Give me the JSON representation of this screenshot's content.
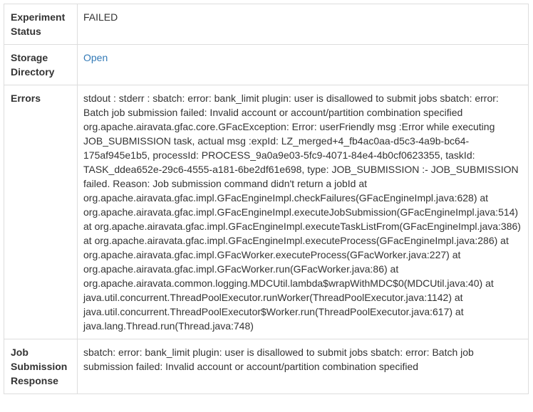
{
  "rows": [
    {
      "label": "Experiment Status",
      "value": "FAILED"
    },
    {
      "label": "Storage Directory",
      "link_text": "Open"
    },
    {
      "label": "Errors",
      "value": "stdout : stderr : sbatch: error: bank_limit plugin: user is disallowed to submit jobs sbatch: error: Batch job submission failed: Invalid account or account/partition combination specified org.apache.airavata.gfac.core.GFacException: Error: userFriendly msg :Error while executing JOB_SUBMISSION task, actual msg :expId: LZ_merged+4_fb4ac0aa-d5c3-4a9b-bc64-175af945e1b5, processId: PROCESS_9a0a9e03-5fc9-4071-84e4-4b0cf0623355, taskId: TASK_ddea652e-29c6-4555-a181-6be2df61e698, type: JOB_SUBMISSION :- JOB_SUBMISSION failed. Reason: Job submission command didn't return a jobId at org.apache.airavata.gfac.impl.GFacEngineImpl.checkFailures(GFacEngineImpl.java:628) at org.apache.airavata.gfac.impl.GFacEngineImpl.executeJobSubmission(GFacEngineImpl.java:514) at org.apache.airavata.gfac.impl.GFacEngineImpl.executeTaskListFrom(GFacEngineImpl.java:386) at org.apache.airavata.gfac.impl.GFacEngineImpl.executeProcess(GFacEngineImpl.java:286) at org.apache.airavata.gfac.impl.GFacWorker.executeProcess(GFacWorker.java:227) at org.apache.airavata.gfac.impl.GFacWorker.run(GFacWorker.java:86) at org.apache.airavata.common.logging.MDCUtil.lambda$wrapWithMDC$0(MDCUtil.java:40) at java.util.concurrent.ThreadPoolExecutor.runWorker(ThreadPoolExecutor.java:1142) at java.util.concurrent.ThreadPoolExecutor$Worker.run(ThreadPoolExecutor.java:617) at java.lang.Thread.run(Thread.java:748)"
    },
    {
      "label": "Job Submission Response",
      "value": "sbatch: error: bank_limit plugin: user is disallowed to submit jobs sbatch: error: Batch job submission failed: Invalid account or account/partition combination specified"
    }
  ],
  "colors": {
    "border": "#dddddd",
    "text": "#333333",
    "link": "#337ab7"
  }
}
